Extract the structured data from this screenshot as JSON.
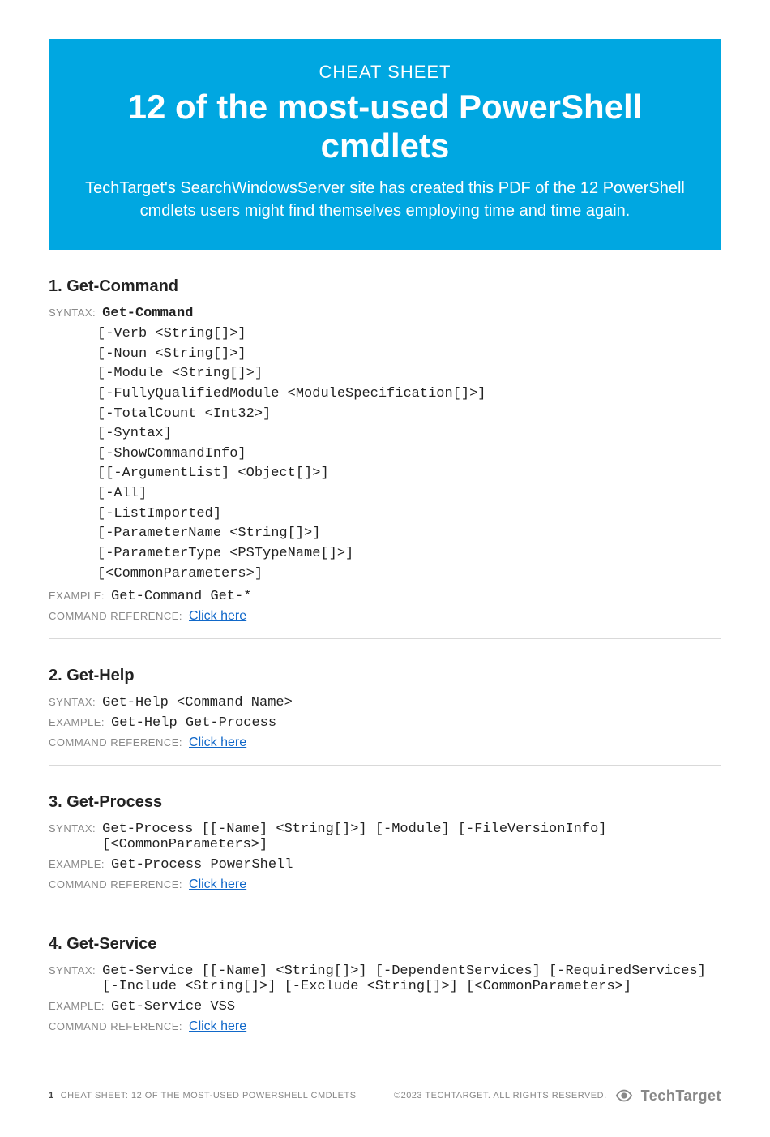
{
  "banner": {
    "label": "CHEAT SHEET",
    "title": "12 of the most-used PowerShell cmdlets",
    "subtitle": "TechTarget's SearchWindowsServer site has created this PDF of the 12 PowerShell cmdlets users might find themselves employing time and time again."
  },
  "labels": {
    "syntax": "SYNTAX:",
    "example": "EXAMPLE:",
    "reference": "COMMAND REFERENCE:",
    "click": "Click here"
  },
  "sections": [
    {
      "title": "1. Get-Command",
      "syntax_cmd": "Get-Command",
      "syntax_block": "[-Verb <String[]>]\n[-Noun <String[]>]\n[-Module <String[]>]\n[-FullyQualifiedModule <ModuleSpecification[]>]\n[-TotalCount <Int32>]\n[-Syntax]\n[-ShowCommandInfo]\n[[-ArgumentList] <Object[]>]\n[-All]\n[-ListImported]\n[-ParameterName <String[]>]\n[-ParameterType <PSTypeName[]>]\n[<CommonParameters>]",
      "example": "Get-Command Get-*"
    },
    {
      "title": "2. Get-Help",
      "syntax_inline": "Get-Help <Command Name>",
      "example": "Get-Help Get-Process"
    },
    {
      "title": "3. Get-Process",
      "syntax_inline": "Get-Process [[-Name] <String[]>] [-Module] [-FileVersionInfo] [<CommonParameters>]",
      "example": "Get-Process PowerShell"
    },
    {
      "title": "4. Get-Service",
      "syntax_inline": "Get-Service [[-Name] <String[]>] [-DependentServices] [-RequiredServices] [-Include <String[]>] [-Exclude <String[]>] [<CommonParameters>]",
      "example": "Get-Service VSS"
    }
  ],
  "footer": {
    "page": "1",
    "title": "CHEAT SHEET: 12 OF THE MOST-USED POWERSHELL CMDLETS",
    "copyright": "©2023 TECHTARGET. ALL RIGHTS RESERVED.",
    "brand": "TechTarget"
  }
}
